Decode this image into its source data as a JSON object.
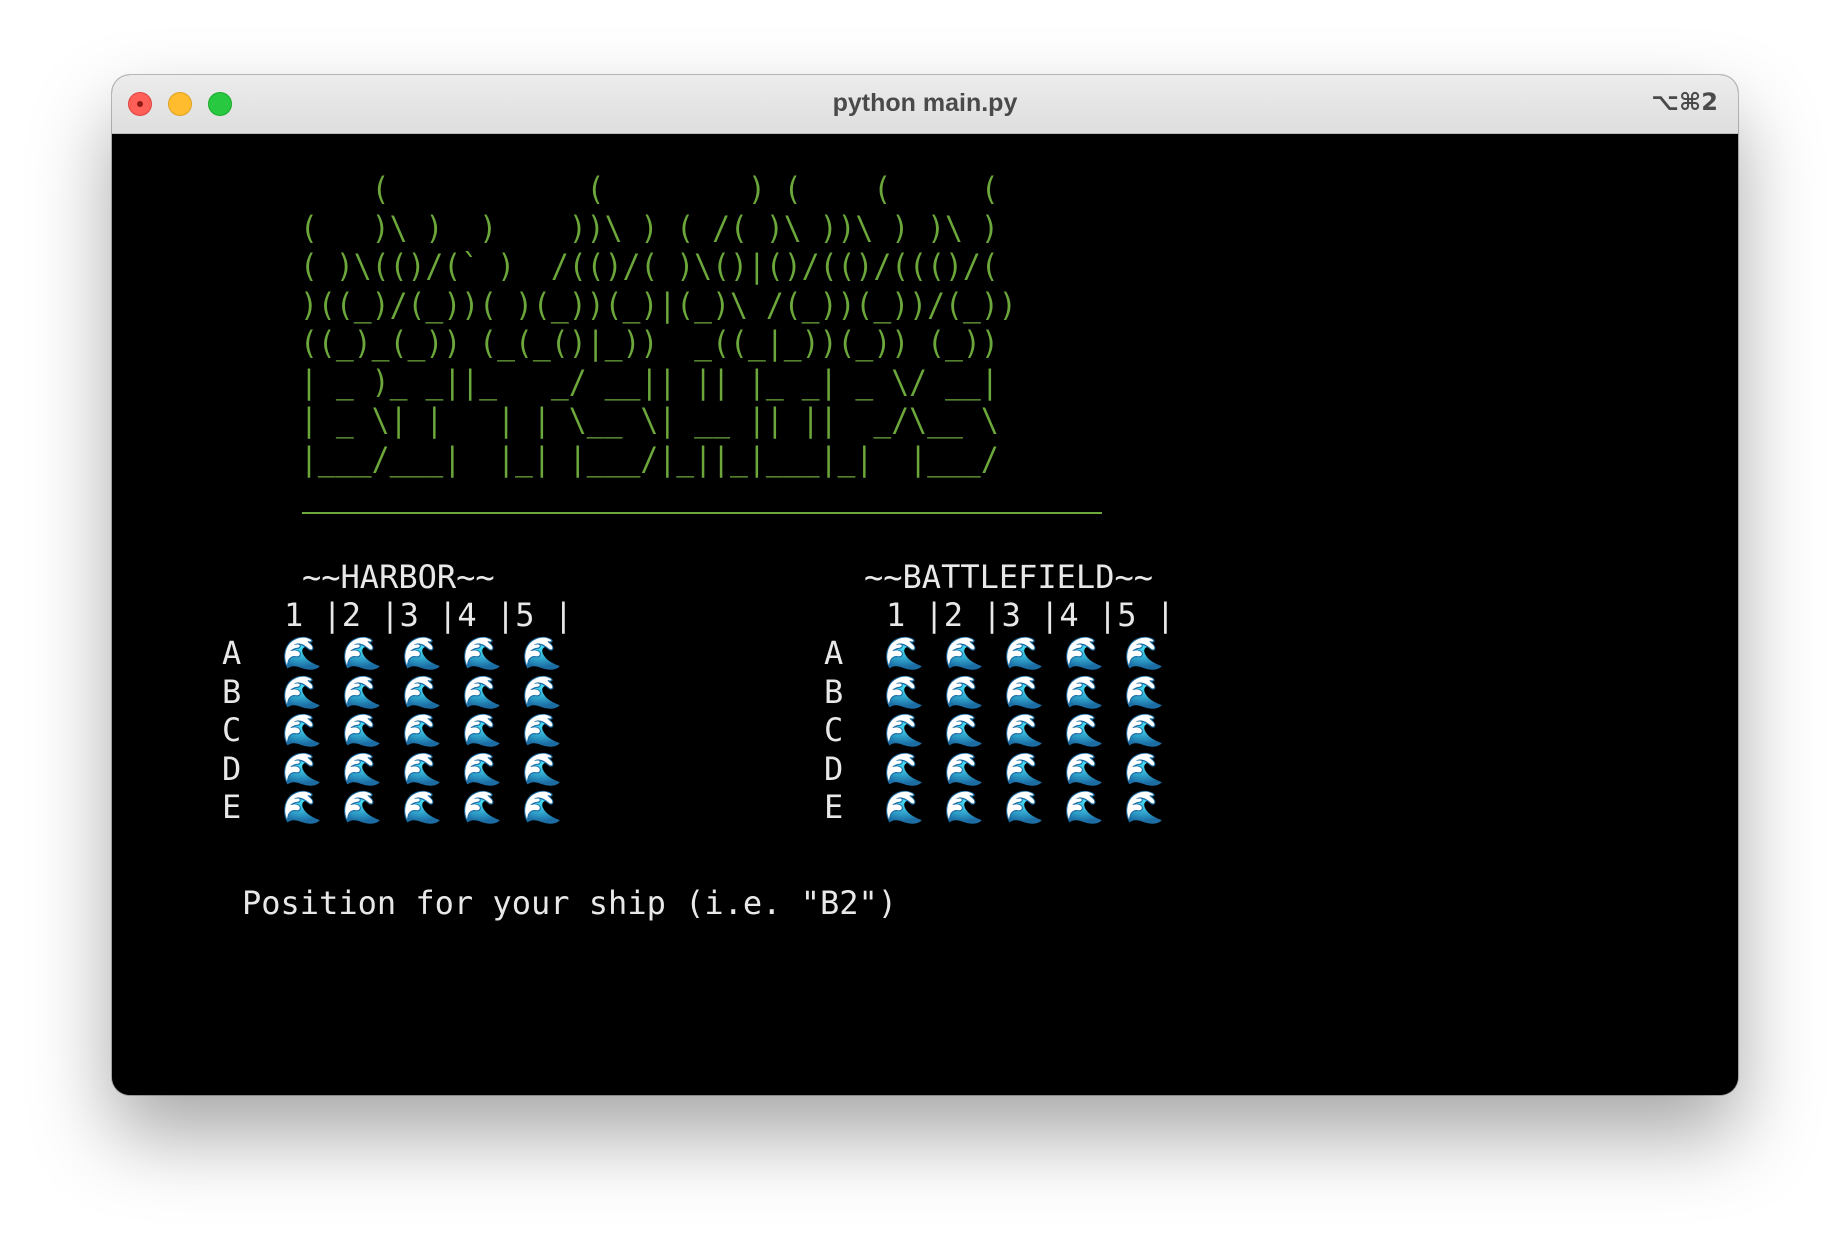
{
  "window": {
    "title": "python main.py",
    "shortcut": "⌥⌘2"
  },
  "banner": {
    "color": "#6ba73a",
    "lines": [
      "    (           (        ) (    (     (",
      "(   )\\ )  )    ))\\ ) ( /( )\\ ))\\ ) )\\ )",
      "( )\\(()/(` )  /(()/( )\\()|()/(()/((()/(",
      ")((_)/(_))( )(_))(_)|(_)\\ /(_))(_))/(_))",
      "((_)_(_)) (_(_()|_))  _((_|_))(_)) (_))",
      "| _ )_ _||_   _/ __|| || |_ _| _ \\/ __|",
      "| _ \\| |   | | \\__ \\| __ || ||  _/\\__ \\",
      "|___/___|  |_| |___/|_||_|___|_|  |___/"
    ]
  },
  "harbor": {
    "title": "~~HARBOR~~",
    "columns": "1 |2 |3 |4 |5 |",
    "rows": [
      {
        "label": "A",
        "cells": [
          "🌊",
          "🌊",
          "🌊",
          "🌊",
          "🌊"
        ]
      },
      {
        "label": "B",
        "cells": [
          "🌊",
          "🌊",
          "🌊",
          "🌊",
          "🌊"
        ]
      },
      {
        "label": "C",
        "cells": [
          "🌊",
          "🌊",
          "🌊",
          "🌊",
          "🌊"
        ]
      },
      {
        "label": "D",
        "cells": [
          "🌊",
          "🌊",
          "🌊",
          "🌊",
          "🌊"
        ]
      },
      {
        "label": "E",
        "cells": [
          "🌊",
          "🌊",
          "🌊",
          "🌊",
          "🌊"
        ]
      }
    ]
  },
  "battlefield": {
    "title": "~~BATTLEFIELD~~",
    "columns": "1 |2 |3 |4 |5 |",
    "rows": [
      {
        "label": "A",
        "cells": [
          "🌊",
          "🌊",
          "🌊",
          "🌊",
          "🌊"
        ]
      },
      {
        "label": "B",
        "cells": [
          "🌊",
          "🌊",
          "🌊",
          "🌊",
          "🌊"
        ]
      },
      {
        "label": "C",
        "cells": [
          "🌊",
          "🌊",
          "🌊",
          "🌊",
          "🌊"
        ]
      },
      {
        "label": "D",
        "cells": [
          "🌊",
          "🌊",
          "🌊",
          "🌊",
          "🌊"
        ]
      },
      {
        "label": "E",
        "cells": [
          "🌊",
          "🌊",
          "🌊",
          "🌊",
          "🌊"
        ]
      }
    ]
  },
  "prompt": "Position for your ship (i.e. \"B2\")"
}
